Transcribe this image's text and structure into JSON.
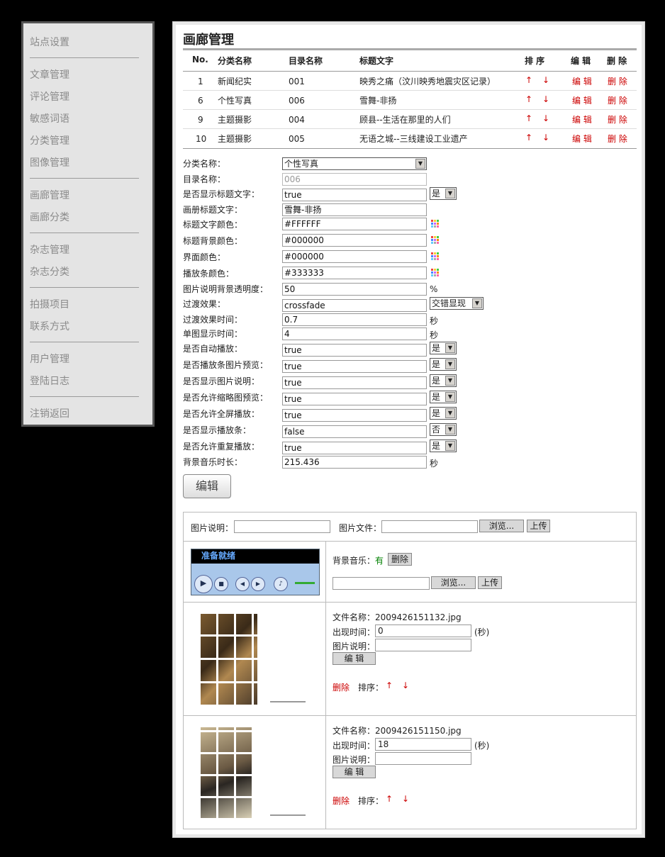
{
  "sidebar": {
    "items": [
      {
        "label": "站点设置"
      },
      {
        "label": "文章管理"
      },
      {
        "label": "评论管理"
      },
      {
        "label": "敏感词语"
      },
      {
        "label": "分类管理"
      },
      {
        "label": "图像管理"
      },
      {
        "label": "画廊管理"
      },
      {
        "label": "画廊分类"
      },
      {
        "label": "杂志管理"
      },
      {
        "label": "杂志分类"
      },
      {
        "label": "拍摄项目"
      },
      {
        "label": "联系方式"
      },
      {
        "label": "用户管理"
      },
      {
        "label": "登陆日志"
      },
      {
        "label": "注销返回"
      }
    ]
  },
  "page": {
    "title": "画廊管理"
  },
  "gallery_table": {
    "headers": {
      "no": "No.",
      "category": "分类名称",
      "dir": "目录名称",
      "title": "标题文字",
      "sort": "排 序",
      "edit": "编 辑",
      "del": "删 除"
    },
    "rows": [
      {
        "no": "1",
        "category": "新闻纪实",
        "dir": "001",
        "title": "映秀之痛（汶川映秀地震灾区记录）",
        "up": "↑",
        "down": "↓",
        "edit": "编 辑",
        "del": "删 除"
      },
      {
        "no": "6",
        "category": "个性写真",
        "dir": "006",
        "title": "雪舞-非扬",
        "up": "↑",
        "down": "↓",
        "edit": "编 辑",
        "del": "删 除"
      },
      {
        "no": "9",
        "category": "主题摄影",
        "dir": "004",
        "title": "顾县--生活在那里的人们",
        "up": "↑",
        "down": "↓",
        "edit": "编 辑",
        "del": "删 除"
      },
      {
        "no": "10",
        "category": "主题摄影",
        "dir": "005",
        "title": "无语之城--三线建设工业遗产",
        "up": "↑",
        "down": "↓",
        "edit": "编 辑",
        "del": "删 除"
      }
    ]
  },
  "form": {
    "category_label": "分类名称：",
    "category_value": "个性写真",
    "dir_label": "目录名称：",
    "dir_value": "006",
    "show_title_label": "是否显示标题文字：",
    "show_title_value": "true",
    "show_title_select": "是",
    "album_title_label": "画册标题文字：",
    "album_title_value": "雪舞-非扬",
    "title_color_label": "标题文字颜色：",
    "title_color_value": "#FFFFFF",
    "title_bg_label": "标题背景颜色：",
    "title_bg_value": "#000000",
    "ui_color_label": "界面颜色：",
    "ui_color_value": "#000000",
    "bar_color_label": "播放条颜色：",
    "bar_color_value": "#333333",
    "caption_alpha_label": "图片说明背景透明度：",
    "caption_alpha_value": "50",
    "caption_alpha_unit": "%",
    "transition_label": "过渡效果：",
    "transition_value": "crossfade",
    "transition_select": "交错显现",
    "transition_time_label": "过渡效果时间：",
    "transition_time_value": "0.7",
    "transition_time_unit": "秒",
    "single_time_label": "单图显示时间：",
    "single_time_value": "4",
    "single_time_unit": "秒",
    "autoplay_label": "是否自动播放：",
    "autoplay_value": "true",
    "autoplay_select": "是",
    "bar_preview_label": "是否播放条图片预览：",
    "bar_preview_value": "true",
    "bar_preview_select": "是",
    "show_caption_label": "是否显示图片说明：",
    "show_caption_value": "true",
    "show_caption_select": "是",
    "thumb_preview_label": "是否允许缩略图预览：",
    "thumb_preview_value": "true",
    "thumb_preview_select": "是",
    "fullscreen_label": "是否允许全屏播放：",
    "fullscreen_value": "true",
    "fullscreen_select": "是",
    "show_bar_label": "是否显示播放条：",
    "show_bar_value": "false",
    "show_bar_select": "否",
    "repeat_label": "是否允许重复播放：",
    "repeat_value": "true",
    "repeat_select": "是",
    "music_len_label": "背景音乐时长：",
    "music_len_value": "215.436",
    "music_len_unit": "秒",
    "edit_button": "编辑"
  },
  "upload": {
    "caption_label": "图片说明：",
    "file_label": "图片文件：",
    "browse": "浏览...",
    "upload": "上传"
  },
  "music": {
    "player_status": "准备就绪",
    "label": "背景音乐：",
    "has": "有",
    "delete": "删除",
    "browse": "浏览...",
    "upload": "上传"
  },
  "images": [
    {
      "filename_label": "文件名称：",
      "filename": "2009426151132.jpg",
      "time_label": "出现时间：",
      "time": "0",
      "time_unit": "(秒)",
      "caption_label": "图片说明：",
      "caption": "",
      "edit": "编 辑",
      "delete": "删除",
      "sort_label": "排序：",
      "up": "↑",
      "down": "↓"
    },
    {
      "filename_label": "文件名称：",
      "filename": "2009426151150.jpg",
      "time_label": "出现时间：",
      "time": "18",
      "time_unit": "(秒)",
      "caption_label": "图片说明：",
      "caption": "",
      "edit": "编 辑",
      "delete": "删除",
      "sort_label": "排序：",
      "up": "↑",
      "down": "↓"
    }
  ],
  "colors": {
    "link_red": "#cc0000",
    "green": "#008000"
  }
}
